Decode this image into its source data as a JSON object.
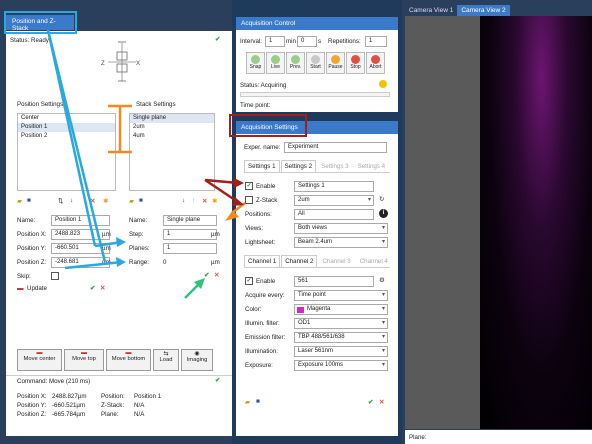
{
  "left": {
    "tab": "Position and Z-Stack",
    "status": "Status: Ready",
    "position_settings": "Position Settings",
    "stack_settings": "Stack Settings",
    "positions": [
      "Center",
      "Position 1",
      "Position 2"
    ],
    "stacks": [
      "Single plane",
      "2um",
      "4um"
    ],
    "name_label": "Name:",
    "name_value": "Position 1",
    "posx_label": "Position X:",
    "posx_value": "2488.823",
    "posx_unit": "µm",
    "posy_label": "Position Y:",
    "posy_value": "-660.501",
    "posy_unit": "µm",
    "posz_label": "Position Z:",
    "posz_value": "-248.681",
    "posz_unit": "µm",
    "skip_label": "Skip:",
    "update_label": "Update",
    "stack_name_label": "Name:",
    "stack_name_value": "Single plane",
    "step_label": "Step:",
    "step_value": "1",
    "step_unit": "µm",
    "planes_label": "Planes:",
    "planes_value": "1",
    "range_label": "Range:",
    "range_value": "0",
    "range_unit": "µm",
    "buttons": [
      "Move center",
      "Move top",
      "Move bottom",
      "Load",
      "Imaging"
    ],
    "command": "Command: Move (210 ms)",
    "info_left": [
      [
        "Position X:",
        "2488.827µm"
      ],
      [
        "Position Y:",
        "-660.521µm"
      ],
      [
        "Position Z:",
        "-665.784µm"
      ]
    ],
    "info_right": [
      [
        "Position:",
        "Position 1"
      ],
      [
        "Z-Stack:",
        "N/A"
      ],
      [
        "Plane:",
        "N/A"
      ]
    ]
  },
  "acq": {
    "title": "Acquisition Control",
    "interval_label": "Interval:",
    "interval_min": "1",
    "min_unit": "min",
    "interval_s": "0",
    "s_unit": "s",
    "repetitions_label": "Repetitions:",
    "repetitions_value": "1",
    "buttons": [
      "Snap",
      "Live",
      "Prev.",
      "Start",
      "Pause",
      "Stop",
      "Abort"
    ],
    "status": "Status: Acquiring",
    "timepoint": "Time point:"
  },
  "settings": {
    "title": "Acquisition Settings",
    "exper_label": "Exper. name:",
    "exper_value": "Experiment",
    "tabs": [
      "Settings 1",
      "Settings 2",
      "Settings 3",
      "Settings 4"
    ],
    "enable_label": "Enable",
    "enable_value": "Settings 1",
    "zstack_label": "Z-Stack",
    "zstack_value": "2um",
    "positions_label": "Positions:",
    "positions_value": "All",
    "views_label": "Views:",
    "views_value": "Both views",
    "lightsheet_label": "Lightsheet:",
    "lightsheet_value": "Beam 2.4um",
    "channel_tabs": [
      "Channel 1",
      "Channel 2",
      "Channel 3",
      "Channel 4"
    ],
    "ch_enable_label": "Enable",
    "ch_enable_value": "561",
    "acquire_label": "Acquire every:",
    "acquire_value": "Time point",
    "color_label": "Color:",
    "color_value": "Magenta",
    "color_hex": "#e01fd0",
    "illum_filter_label": "Illumin. filter:",
    "illum_filter_value": "OD1",
    "emission_label": "Emission filter:",
    "emission_value": "TBP 488/561/638",
    "illumination_label": "Illumination:",
    "illumination_value": "Laser 561nm",
    "exposure_label": "Exposure:",
    "exposure_value": "Exposure 100ms"
  },
  "camera": {
    "tabs": [
      "Camera View 1",
      "Camera View 2"
    ],
    "plane_label": "Plane:"
  }
}
